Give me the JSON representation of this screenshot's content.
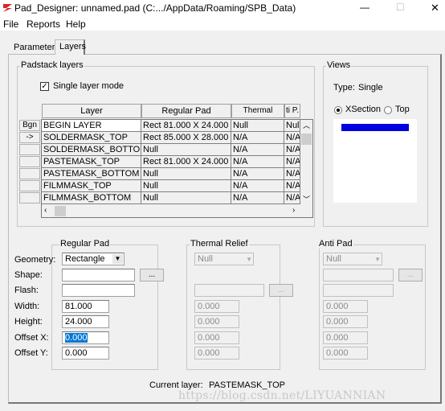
{
  "window": {
    "title": "Pad_Designer: unnamed.pad (C:.../AppData/Roaming/SPB_Data)",
    "minimize": "—",
    "maximize": "□",
    "close": "✕"
  },
  "menu": [
    "File",
    "Reports",
    "Help"
  ],
  "tabs": [
    {
      "label": "Parameters",
      "active": false
    },
    {
      "label": "Layers",
      "active": true
    }
  ],
  "padstack": {
    "group_label": "Padstack layers",
    "single_layer_mode": {
      "label": "Single layer mode",
      "checked": true
    },
    "columns": [
      "Layer",
      "Regular Pad",
      "Thermal Relief",
      "ti P."
    ],
    "row_buttons": [
      "Bgn",
      "->",
      "",
      "",
      "",
      "",
      ""
    ],
    "rows": [
      [
        "BEGIN LAYER",
        "Rect 81.000 X 24.000",
        "Null",
        "Null"
      ],
      [
        "SOLDERMASK_TOP",
        "Rect 85.000 X 28.000",
        "N/A",
        "N/A"
      ],
      [
        "SOLDERMASK_BOTTOM",
        "Null",
        "N/A",
        "N/A"
      ],
      [
        "PASTEMASK_TOP",
        "Rect 81.000 X 24.000",
        "N/A",
        "N/A"
      ],
      [
        "PASTEMASK_BOTTOM",
        "Null",
        "N/A",
        "N/A"
      ],
      [
        "FILMMASK_TOP",
        "Null",
        "N/A",
        "N/A"
      ],
      [
        "FILMMASK_BOTTOM",
        "Null",
        "N/A",
        "N/A"
      ]
    ]
  },
  "views": {
    "group_label": "Views",
    "type_label": "Type:",
    "type_value": "Single",
    "radio_xsection": "XSection",
    "radio_top": "Top",
    "selected": "XSection",
    "layer_color": "#0000e0"
  },
  "labels": {
    "geometry": "Geometry:",
    "shape": "Shape:",
    "flash": "Flash:",
    "width": "Width:",
    "height": "Height:",
    "offset_x": "Offset X:",
    "offset_y": "Offset Y:"
  },
  "regular_pad": {
    "label": "Regular Pad",
    "geometry": "Rectangle",
    "shape": "",
    "flash": "",
    "width": "81.000",
    "height": "24.000",
    "offset_x": "0.000",
    "offset_y": "0.000",
    "browse": "..."
  },
  "thermal_relief": {
    "label": "Thermal Relief",
    "geometry": "Null",
    "flash": "",
    "width": "0.000",
    "height": "0.000",
    "offset_x": "0.000",
    "offset_y": "0.000",
    "browse": "..."
  },
  "anti_pad": {
    "label": "Anti Pad",
    "geometry": "Null",
    "shape": "",
    "flash": "",
    "width": "0.000",
    "height": "0.000",
    "offset_x": "0.000",
    "offset_y": "0.000",
    "browse": "..."
  },
  "current_layer": {
    "label": "Current layer:",
    "value": "PASTEMASK_TOP"
  },
  "watermark": "https://blog.csdn.net/LIYUANNIAN"
}
